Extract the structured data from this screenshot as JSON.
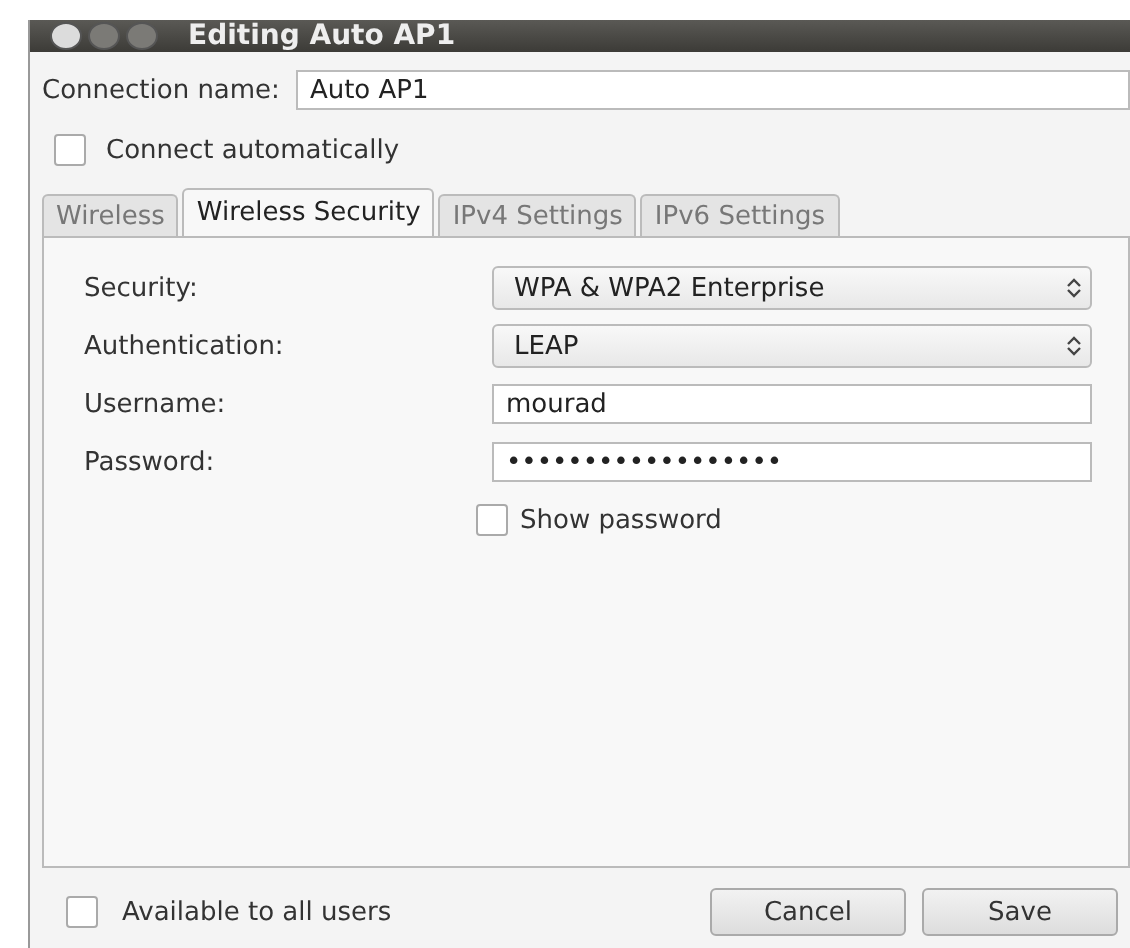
{
  "window": {
    "title": "Editing Auto AP1"
  },
  "connection_name": {
    "label": "Connection name:",
    "value": "Auto AP1"
  },
  "connect_automatically": {
    "label": "Connect automatically",
    "checked": false
  },
  "tabs": [
    {
      "label": "Wireless",
      "selected": false
    },
    {
      "label": "Wireless Security",
      "selected": true
    },
    {
      "label": "IPv4 Settings",
      "selected": false
    },
    {
      "label": "IPv6 Settings",
      "selected": false
    }
  ],
  "fields": [
    {
      "kind": "combo",
      "label": "Security:",
      "value": "WPA & WPA2 Enterprise"
    },
    {
      "kind": "combo",
      "label": "Authentication:",
      "value": "LEAP"
    },
    {
      "kind": "entry",
      "label": "Username:",
      "value": "mourad"
    },
    {
      "kind": "entry",
      "label": "Password:",
      "value": "••••••••••••••••••"
    }
  ],
  "show_password": {
    "label": "Show password",
    "checked": false
  },
  "available_to_all_users": {
    "label": "Available to all users",
    "checked": false
  },
  "buttons": [
    "Cancel",
    "Save"
  ]
}
